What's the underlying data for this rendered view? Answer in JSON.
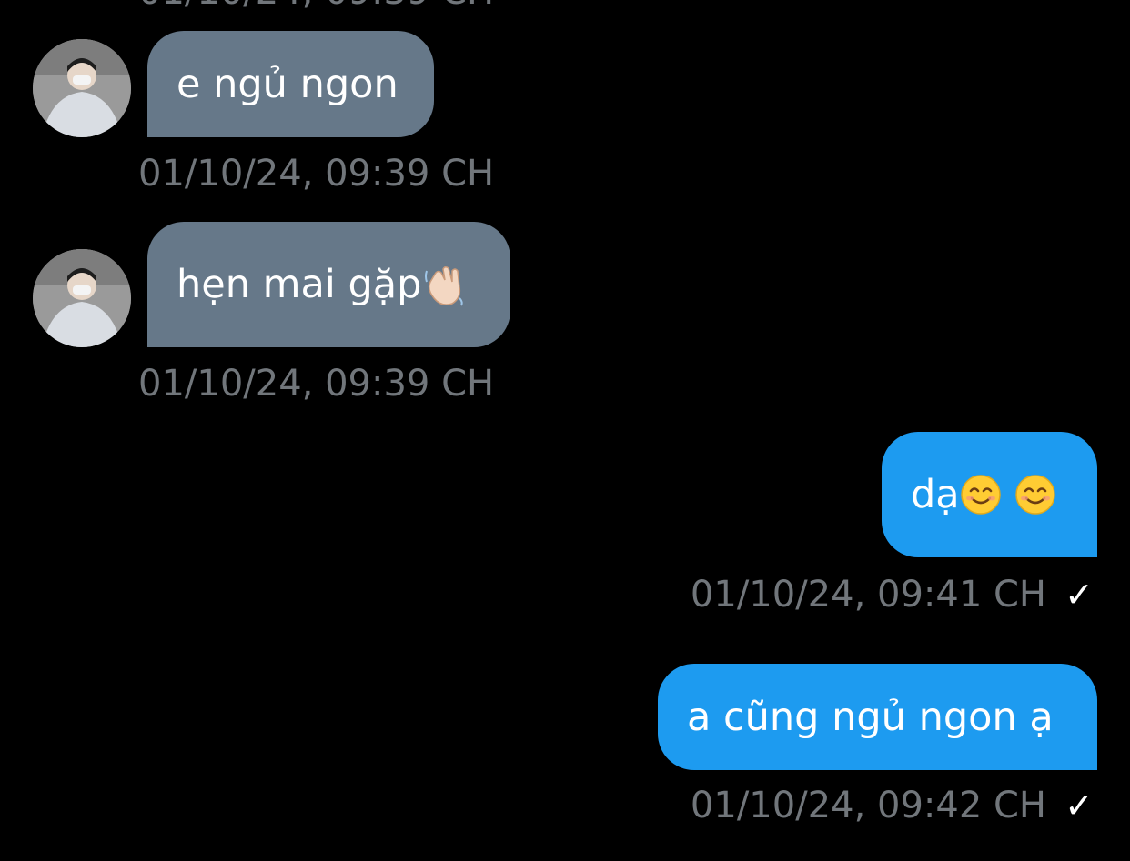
{
  "conversation": {
    "top_partial_timestamp": "01/10/24, 09:39 CH",
    "messages": [
      {
        "direction": "incoming",
        "text": "e ngủ ngon",
        "timestamp": "01/10/24, 09:39 CH"
      },
      {
        "direction": "incoming",
        "text": "hẹn mai gặp",
        "emoji": "waving-hand",
        "timestamp": "01/10/24, 09:39 CH"
      },
      {
        "direction": "outgoing",
        "text": "dạ",
        "emoji": "smiling-face-x2",
        "timestamp": "01/10/24, 09:41 CH",
        "status": "✓"
      },
      {
        "direction": "outgoing",
        "text": "a cũng ngủ ngon ạ",
        "timestamp": "01/10/24, 09:42 CH",
        "status": "✓"
      }
    ]
  },
  "colors": {
    "background": "#000000",
    "incoming_bubble": "#667889",
    "outgoing_bubble": "#1d9bf0",
    "timestamp": "#71767b",
    "text": "#ffffff"
  }
}
